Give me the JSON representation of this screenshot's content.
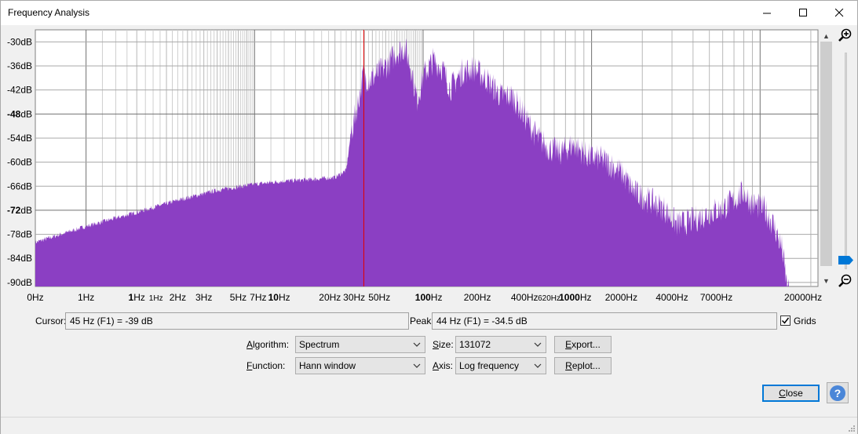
{
  "window": {
    "title": "Frequency Analysis",
    "controls": {
      "minimize": "—",
      "maximize": "☐",
      "close": "✕"
    }
  },
  "plot": {
    "fill_color": "#8b3fc3",
    "cursor_color": "#e00000",
    "db_labels": [
      {
        "text": "-30dB",
        "db": -30
      },
      {
        "text": "-36dB",
        "db": -36
      },
      {
        "text": "-42dB",
        "db": -42
      },
      {
        "text": "-48dB",
        "db": -48
      },
      {
        "text": "-54dB",
        "db": -54
      },
      {
        "text": "-60dB",
        "db": -60
      },
      {
        "text": "-66dB",
        "db": -66
      },
      {
        "text": "-72dB",
        "db": -72
      },
      {
        "text": "-78dB",
        "db": -78
      },
      {
        "text": "-84dB",
        "db": -84
      },
      {
        "text": "-90dB",
        "db": -90
      }
    ],
    "freq_labels": [
      {
        "text": "0Hz",
        "hz": 0.5
      },
      {
        "text": "1Hz",
        "hz": 1
      },
      {
        "text": "1Hz",
        "hz": 2,
        "bold_prefix": true
      },
      {
        "text": "1Hz",
        "hz": 2.6,
        "small": true
      },
      {
        "text": "2Hz",
        "hz": 3.5
      },
      {
        "text": "3Hz",
        "hz": 5
      },
      {
        "text": "5Hz",
        "hz": 8
      },
      {
        "text": "7Hz",
        "hz": 10.5
      },
      {
        "text": "10Hz",
        "hz": 14,
        "bold_prefix": true
      },
      {
        "text": "20Hz",
        "hz": 28
      },
      {
        "text": "30Hz",
        "hz": 39
      },
      {
        "text": "50Hz",
        "hz": 55
      },
      {
        "text": "100Hz",
        "hz": 108,
        "bold_prefix": true
      },
      {
        "text": "200Hz",
        "hz": 210
      },
      {
        "text": "400Hz",
        "hz": 400
      },
      {
        "text": "620Hz",
        "hz": 560,
        "small": true
      },
      {
        "text": "1000Hz",
        "hz": 800,
        "bold_prefix": true
      },
      {
        "text": "2000Hz",
        "hz": 1500
      },
      {
        "text": "4000Hz",
        "hz": 3000
      },
      {
        "text": "7000Hz",
        "hz": 5500
      },
      {
        "text": "20000Hz",
        "hz": 18000
      }
    ],
    "range": {
      "db_min": -91,
      "db_max": -27,
      "hz_min": 0.5,
      "hz_max": 22050
    }
  },
  "readouts": {
    "cursor_label": "Cursor:",
    "cursor_value": "45 Hz (F1) = -39 dB",
    "peak_label": "Peak:",
    "peak_value": "44 Hz (F1) = -34.5 dB",
    "grids_label": "Grids",
    "grids_checked": true
  },
  "controls": {
    "algorithm_label_u": "A",
    "algorithm_label_rest": "lgorithm:",
    "algorithm_value": "Spectrum",
    "function_label_u": "F",
    "function_label_rest": "unction:",
    "function_value": "Hann window",
    "size_label_u": "S",
    "size_label_rest": "ize:",
    "size_value": "131072",
    "axis_label_u": "A",
    "axis_label_rest": "xis:",
    "axis_value": "Log frequency",
    "export_u": "E",
    "export_rest": "xport...",
    "replot_u": "R",
    "replot_rest": "eplot...",
    "close_u": "C",
    "close_rest": "lose",
    "help_icon": "?"
  }
}
